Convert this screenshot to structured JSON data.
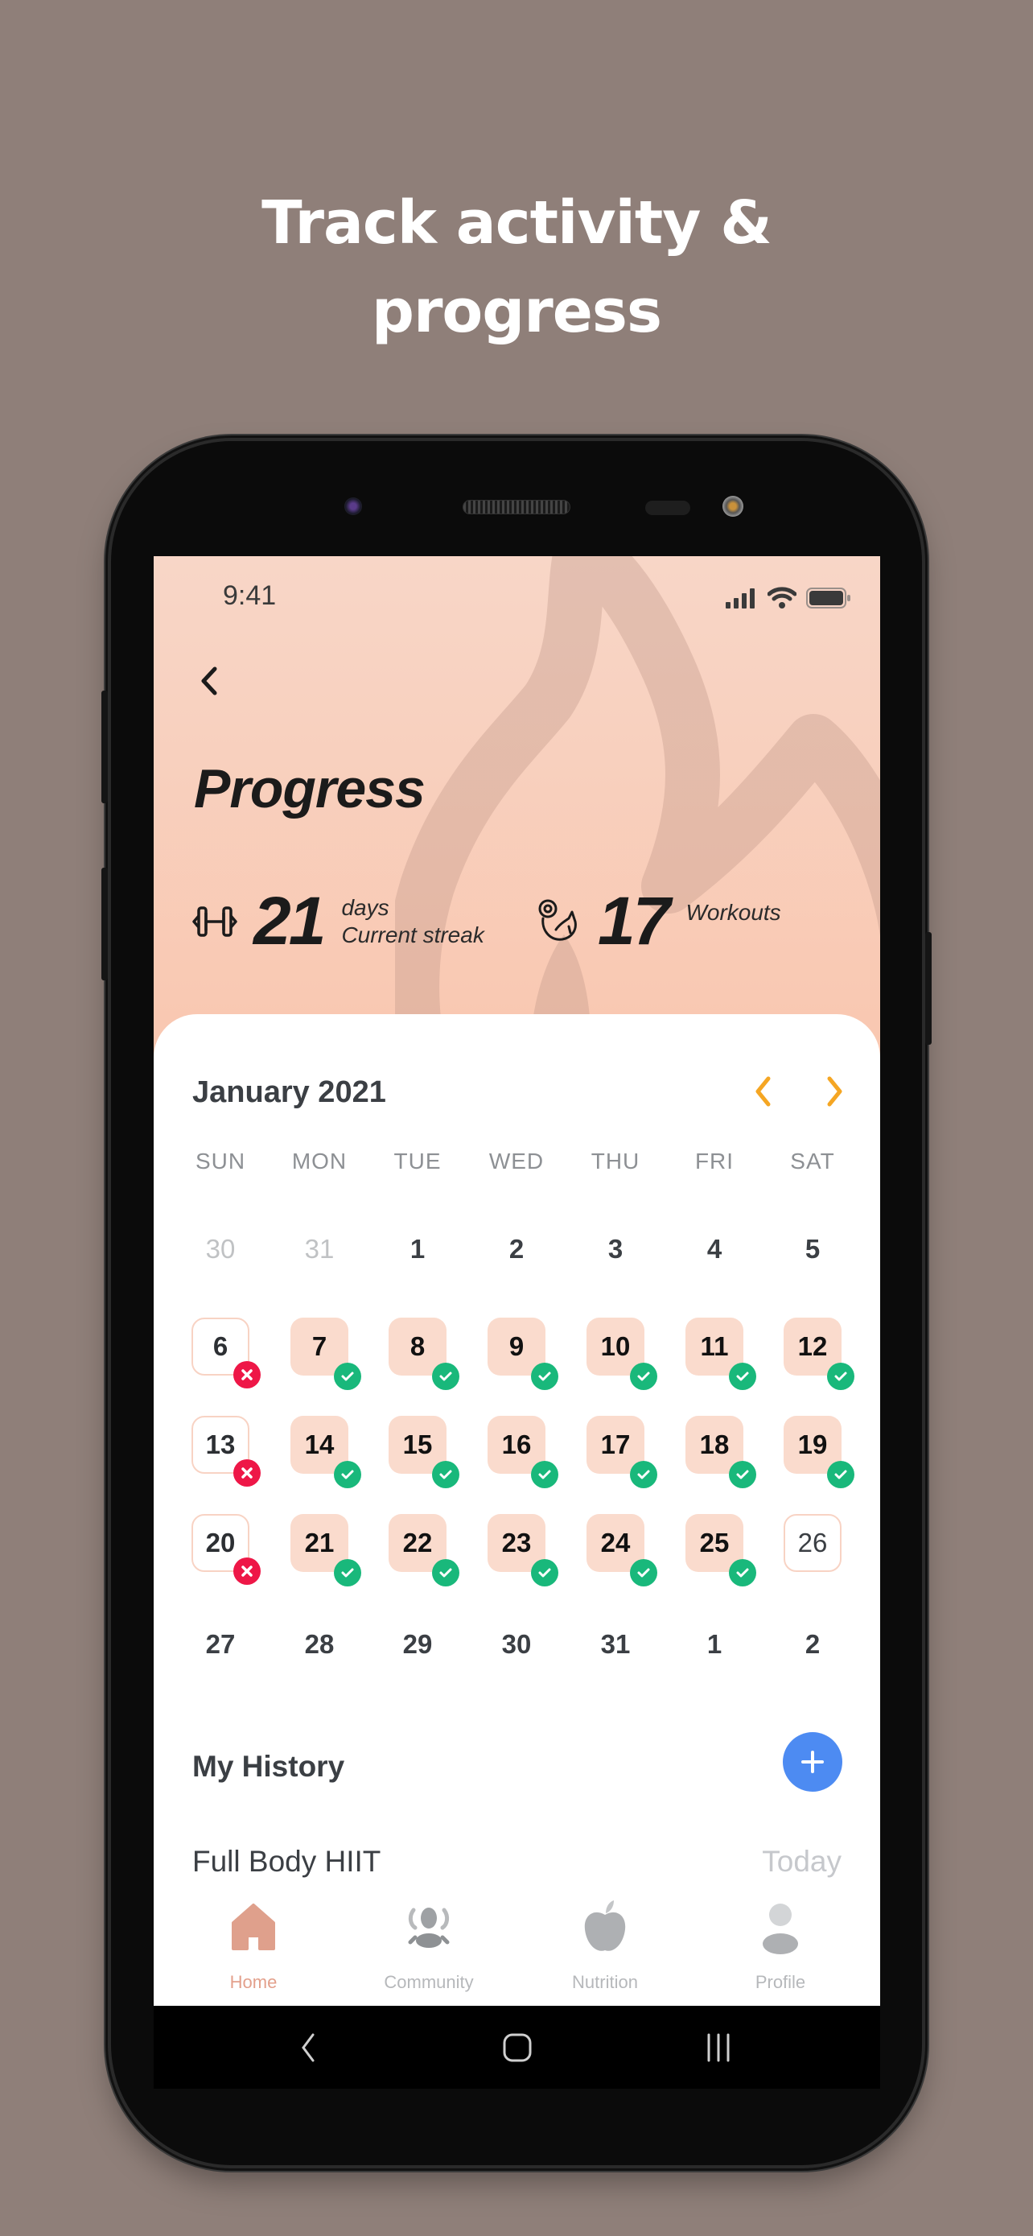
{
  "headline": {
    "line1": "Track activity &",
    "line2": "progress"
  },
  "status_bar": {
    "time": "9:41",
    "icons": [
      "signal-icon",
      "wifi-icon",
      "battery-icon"
    ]
  },
  "header": {
    "back_icon": "chevron-left-icon",
    "title": "Progress",
    "stats": [
      {
        "icon": "dumbbell-icon",
        "value": "21",
        "label_top": "days",
        "label_bottom": "Current streak"
      },
      {
        "icon": "flexed-arm-icon",
        "value": "17",
        "label_top": "Workouts",
        "label_bottom": ""
      }
    ]
  },
  "calendar": {
    "month_label": "January 2021",
    "prev_icon": "chevron-left-icon",
    "next_icon": "chevron-right-icon",
    "accent": "#f5a623",
    "weekdays": [
      "SUN",
      "MON",
      "TUE",
      "WED",
      "THU",
      "FRI",
      "SAT"
    ],
    "weeks": [
      [
        {
          "d": "30",
          "s": "muted"
        },
        {
          "d": "31",
          "s": "muted"
        },
        {
          "d": "1",
          "s": "plain"
        },
        {
          "d": "2",
          "s": "plain"
        },
        {
          "d": "3",
          "s": "plain"
        },
        {
          "d": "4",
          "s": "plain"
        },
        {
          "d": "5",
          "s": "plain"
        }
      ],
      [
        {
          "d": "6",
          "s": "miss"
        },
        {
          "d": "7",
          "s": "done"
        },
        {
          "d": "8",
          "s": "done"
        },
        {
          "d": "9",
          "s": "done"
        },
        {
          "d": "10",
          "s": "done"
        },
        {
          "d": "11",
          "s": "done"
        },
        {
          "d": "12",
          "s": "done"
        }
      ],
      [
        {
          "d": "13",
          "s": "miss"
        },
        {
          "d": "14",
          "s": "done"
        },
        {
          "d": "15",
          "s": "done"
        },
        {
          "d": "16",
          "s": "done"
        },
        {
          "d": "17",
          "s": "done"
        },
        {
          "d": "18",
          "s": "done"
        },
        {
          "d": "19",
          "s": "done"
        }
      ],
      [
        {
          "d": "20",
          "s": "miss"
        },
        {
          "d": "21",
          "s": "done"
        },
        {
          "d": "22",
          "s": "done"
        },
        {
          "d": "23",
          "s": "done"
        },
        {
          "d": "24",
          "s": "done"
        },
        {
          "d": "25",
          "s": "done"
        },
        {
          "d": "26",
          "s": "upcoming"
        }
      ],
      [
        {
          "d": "27",
          "s": "plain"
        },
        {
          "d": "28",
          "s": "plain"
        },
        {
          "d": "29",
          "s": "plain"
        },
        {
          "d": "30",
          "s": "plain"
        },
        {
          "d": "31",
          "s": "plain"
        },
        {
          "d": "1",
          "s": "plain"
        },
        {
          "d": "2",
          "s": "plain"
        }
      ]
    ],
    "status_colors": {
      "done": "#19b87b",
      "miss": "#ee1747",
      "done_bg": "#fadbcd"
    }
  },
  "history": {
    "title": "My History",
    "add_icon": "plus-icon",
    "items": [
      {
        "name": "Full Body HIIT",
        "date": "Today"
      }
    ]
  },
  "tabbar": {
    "active_color": "#e3a08c",
    "tabs": [
      {
        "label": "Home",
        "icon": "home-icon",
        "active": true
      },
      {
        "label": "Community",
        "icon": "community-icon",
        "active": false
      },
      {
        "label": "Nutrition",
        "icon": "apple-icon",
        "active": false
      },
      {
        "label": "Profile",
        "icon": "profile-icon",
        "active": false
      }
    ]
  },
  "system_nav": {
    "buttons": [
      "back-icon",
      "home-circle-icon",
      "recents-icon"
    ]
  }
}
